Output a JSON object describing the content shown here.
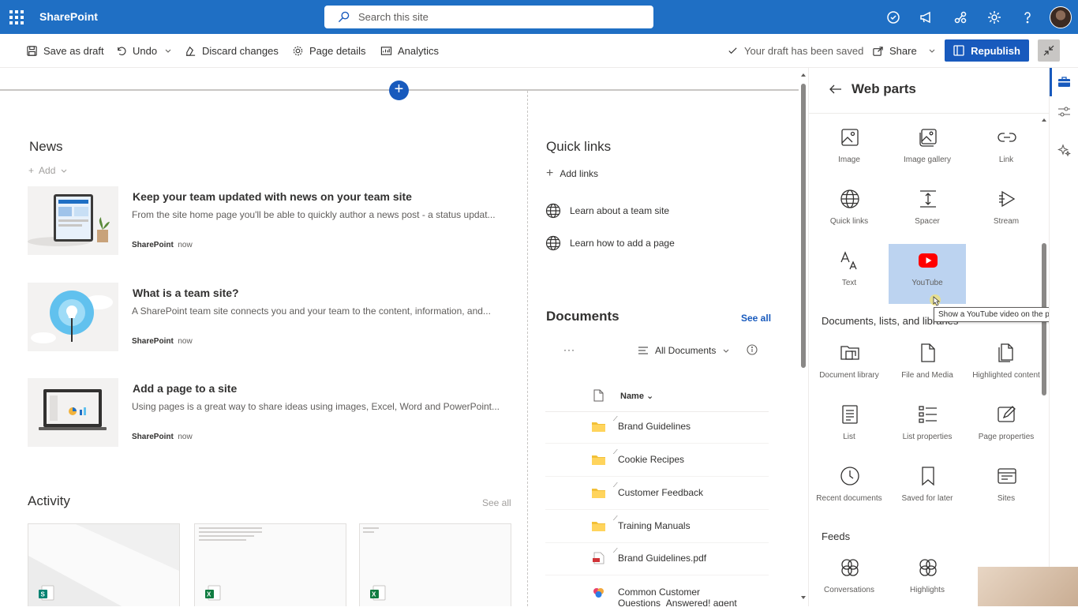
{
  "suite_bar": {
    "brand": "SharePoint",
    "search_placeholder": "Search this site"
  },
  "command_bar": {
    "save_draft": "Save as draft",
    "undo": "Undo",
    "discard": "Discard changes",
    "page_details": "Page details",
    "analytics": "Analytics",
    "draft_status": "Your draft has been saved",
    "share": "Share",
    "republish": "Republish"
  },
  "news": {
    "heading": "News",
    "add": "Add",
    "items": [
      {
        "title": "Keep your team updated with news on your team site",
        "desc": "From the site home page you'll be able to quickly author a news post - a status updat...",
        "author": "SharePoint",
        "time": "now"
      },
      {
        "title": "What is a team site?",
        "desc": "A SharePoint team site connects you and your team to the content, information, and...",
        "author": "SharePoint",
        "time": "now"
      },
      {
        "title": "Add a page to a site",
        "desc": "Using pages is a great way to share ideas using images, Excel, Word and PowerPoint...",
        "author": "SharePoint",
        "time": "now"
      }
    ]
  },
  "activity": {
    "heading": "Activity",
    "see_all": "See all"
  },
  "quick_links": {
    "heading": "Quick links",
    "add": "Add links",
    "items": [
      "Learn about a team site",
      "Learn how to add a page"
    ]
  },
  "documents": {
    "heading": "Documents",
    "see_all": "See all",
    "more": "···",
    "view": "All Documents",
    "column_name": "Name",
    "rows": [
      "Brand Guidelines",
      "Cookie Recipes",
      "Customer Feedback",
      "Training Manuals",
      "Brand Guidelines.pdf",
      "Common Customer Questions_Answered! agent"
    ]
  },
  "panel": {
    "title": "Web parts",
    "web_parts": [
      "Image",
      "Image gallery",
      "Link",
      "Quick links",
      "Spacer",
      "Stream",
      "Text",
      "YouTube"
    ],
    "section_docs": "Documents, lists, and libraries",
    "docs_parts": [
      "Document library",
      "File and Media",
      "Highlighted content",
      "List",
      "List properties",
      "Page properties",
      "Recent documents",
      "Saved for later",
      "Sites"
    ],
    "section_feeds": "Feeds",
    "feeds_parts": [
      "Conversations",
      "Highlights"
    ],
    "tooltip": "Show a YouTube video on the page."
  },
  "colors": {
    "suite_bar": "#1f6fc4",
    "accent": "#185abd",
    "selected_tile": "#bcd3f0",
    "youtube_red": "#ff0000"
  }
}
